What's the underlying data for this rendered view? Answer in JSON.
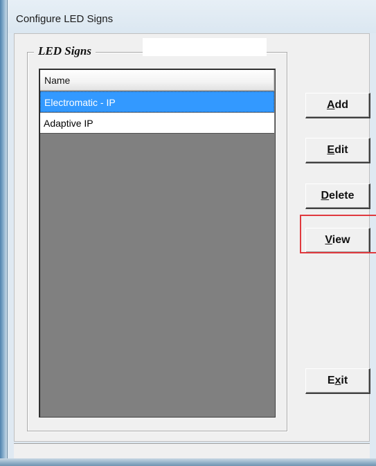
{
  "window": {
    "title": "Configure LED Signs"
  },
  "group": {
    "legend": "LED Signs"
  },
  "list": {
    "column_header": "Name",
    "rows": [
      {
        "name": "Electromatic - IP",
        "selected": true
      },
      {
        "name": "Adaptive IP",
        "selected": false
      }
    ]
  },
  "buttons": {
    "add": {
      "prefix": "",
      "mnemonic": "A",
      "rest": "dd"
    },
    "edit": {
      "prefix": "",
      "mnemonic": "E",
      "rest": "dit"
    },
    "delete": {
      "prefix": "",
      "mnemonic": "D",
      "rest": "elete"
    },
    "view": {
      "prefix": "",
      "mnemonic": "V",
      "rest": "iew",
      "highlighted": true
    },
    "exit": {
      "prefix": "E",
      "mnemonic": "x",
      "rest": "it"
    }
  },
  "colors": {
    "selection": "#3399ff",
    "highlight_outline": "#e0393e",
    "list_background": "#808080"
  }
}
